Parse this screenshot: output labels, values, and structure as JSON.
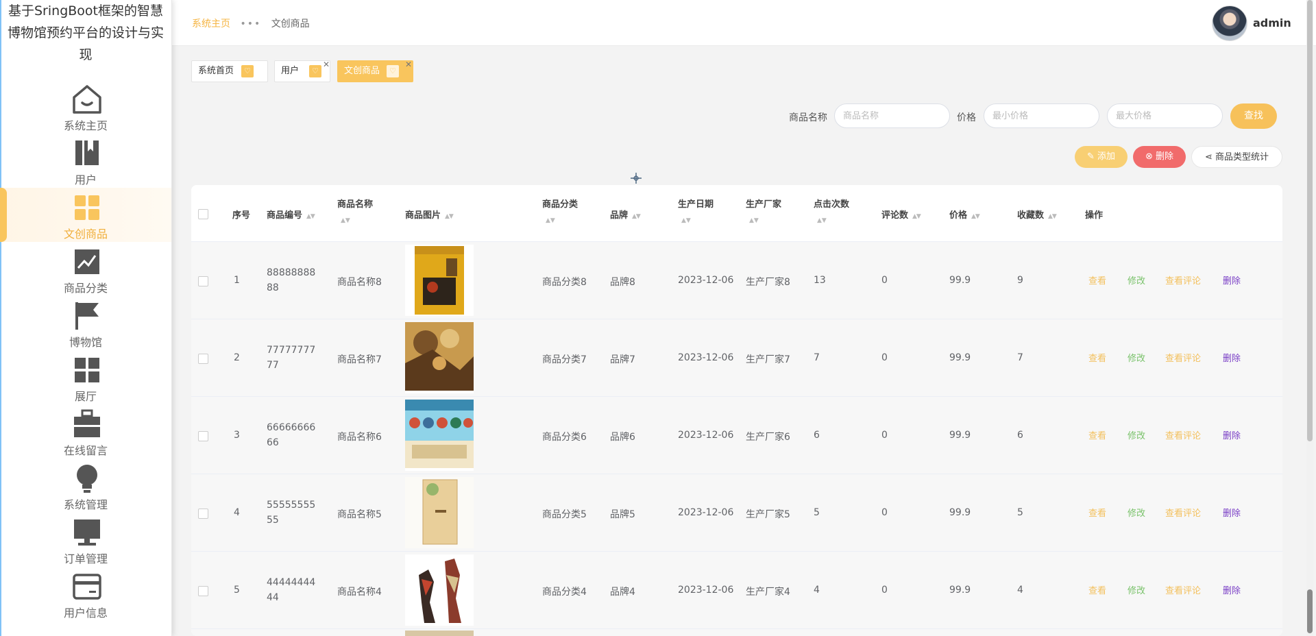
{
  "sidebar": {
    "brand": "基于SringBoot框架的智慧博物馆预约平台的设计与实现",
    "items": [
      {
        "label": "系统主页",
        "icon": "home-icon"
      },
      {
        "label": "用户",
        "icon": "bookmark-icon"
      },
      {
        "label": "文创商品",
        "icon": "grid-icon",
        "active": true
      },
      {
        "label": "商品分类",
        "icon": "chart-icon"
      },
      {
        "label": "博物馆",
        "icon": "flag-icon"
      },
      {
        "label": "展厅",
        "icon": "apps-icon"
      },
      {
        "label": "在线留言",
        "icon": "briefcase-icon"
      },
      {
        "label": "系统管理",
        "icon": "bulb-icon"
      },
      {
        "label": "订单管理",
        "icon": "monitor-icon"
      },
      {
        "label": "用户信息",
        "icon": "card-icon"
      }
    ]
  },
  "header": {
    "breadcrumb_home": "系统主页",
    "breadcrumb_current": "文创商品",
    "username": "admin"
  },
  "tabs": [
    {
      "label": "系统首页"
    },
    {
      "label": "用户",
      "closable": true
    },
    {
      "label": "文创商品",
      "closable": true,
      "active": true
    }
  ],
  "search": {
    "name_label": "商品名称",
    "name_placeholder": "商品名称",
    "price_label": "价格",
    "min_placeholder": "最小价格",
    "max_placeholder": "最大价格",
    "find_label": "查找"
  },
  "actions": {
    "add_label": "添加",
    "delete_label": "删除",
    "stats_label": "商品类型统计"
  },
  "table": {
    "columns": [
      "序号",
      "商品编号",
      "商品名称",
      "商品图片",
      "商品分类",
      "品牌",
      "生产日期",
      "生产厂家",
      "点击次数",
      "评论数",
      "价格",
      "收藏数",
      "操作"
    ],
    "row_actions": {
      "view": "查看",
      "edit": "修改",
      "comments": "查看评论",
      "delete": "删除"
    },
    "rows": [
      {
        "index": "1",
        "code": "8888888888",
        "name": "商品名称8",
        "category": "商品分类8",
        "brand": "品牌8",
        "date": "2023-12-06",
        "maker": "生产厂家8",
        "clicks": "13",
        "comments": "0",
        "price": "99.9",
        "favorites": "9"
      },
      {
        "index": "2",
        "code": "7777777777",
        "name": "商品名称7",
        "category": "商品分类7",
        "brand": "品牌7",
        "date": "2023-12-06",
        "maker": "生产厂家7",
        "clicks": "7",
        "comments": "0",
        "price": "99.9",
        "favorites": "7"
      },
      {
        "index": "3",
        "code": "6666666666",
        "name": "商品名称6",
        "category": "商品分类6",
        "brand": "品牌6",
        "date": "2023-12-06",
        "maker": "生产厂家6",
        "clicks": "6",
        "comments": "0",
        "price": "99.9",
        "favorites": "6"
      },
      {
        "index": "4",
        "code": "5555555555",
        "name": "商品名称5",
        "category": "商品分类5",
        "brand": "品牌5",
        "date": "2023-12-06",
        "maker": "生产厂家5",
        "clicks": "5",
        "comments": "0",
        "price": "99.9",
        "favorites": "5"
      },
      {
        "index": "5",
        "code": "4444444444",
        "name": "商品名称4",
        "category": "商品分类4",
        "brand": "品牌4",
        "date": "2023-12-06",
        "maker": "生产厂家4",
        "clicks": "4",
        "comments": "0",
        "price": "99.9",
        "favorites": "4"
      }
    ]
  },
  "colors": {
    "accent": "#f9c55d",
    "danger": "#f16b6b",
    "edit": "#79c26a",
    "delete_link": "#7a3fc6"
  }
}
